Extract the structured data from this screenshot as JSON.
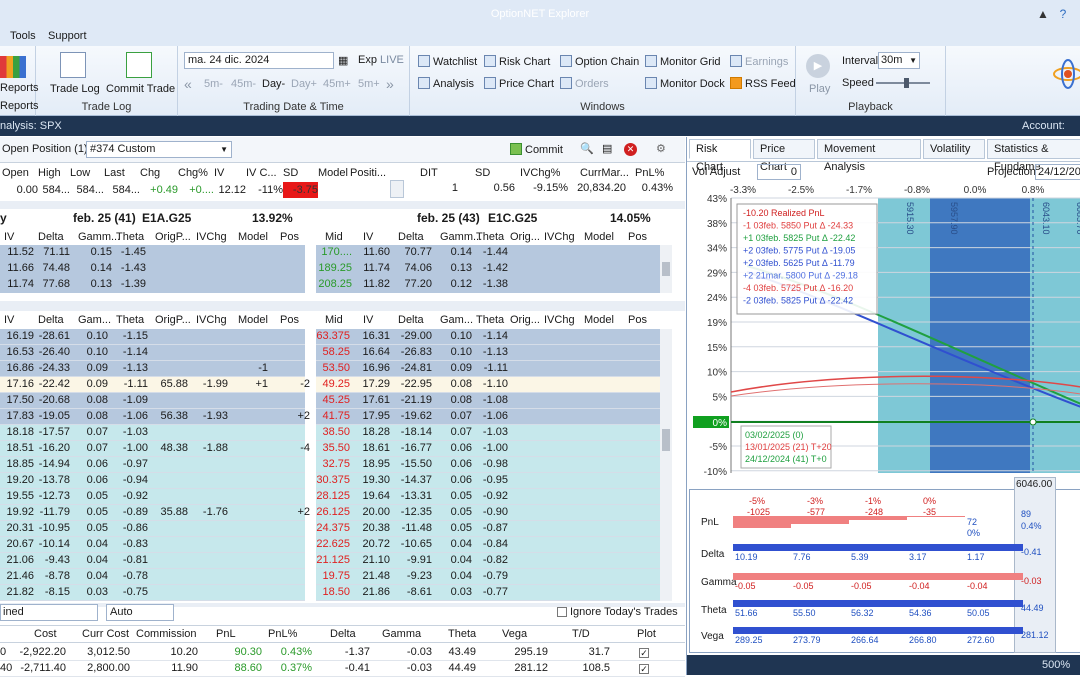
{
  "app": {
    "title": "OptionNET Explorer"
  },
  "menu": [
    "Tools",
    "Support"
  ],
  "ribbon": {
    "reports_label": "Reports",
    "reports_group": "Reports",
    "trade_log": "Trade Log",
    "commit_trade": "Commit Trade",
    "trade_log_group": "Trade Log",
    "date_value": "ma. 24 dic. 2024",
    "exp": "Exp",
    "live": "LIVE",
    "nav": [
      "5m-",
      "45m-",
      "Day-",
      "Day+",
      "45m+",
      "5m+"
    ],
    "date_group": "Trading Date & Time",
    "windows": {
      "watchlist": "Watchlist",
      "risk_chart": "Risk Chart",
      "option_chain": "Option Chain",
      "monitor_grid": "Monitor Grid",
      "earnings": "Earnings",
      "analysis": "Analysis",
      "price_chart": "Price Chart",
      "orders": "Orders",
      "monitor_dock": "Monitor Dock",
      "rss_feed": "RSS Feed",
      "group": "Windows"
    },
    "playback": {
      "play": "Play",
      "interval_label": "Interval",
      "interval_value": "30m",
      "speed_label": "Speed",
      "group": "Playback"
    }
  },
  "status": {
    "left": "nalysis: SPX",
    "right": "Account: Est"
  },
  "position": {
    "label": "Open Position (1)",
    "custom": "#374 Custom",
    "commit": "Commit"
  },
  "top_headers": [
    "Open",
    "High",
    "Low",
    "Last",
    "Chg",
    "Chg%",
    "IV",
    "IV C...",
    "SD",
    "Model",
    "Positi..."
  ],
  "top_values": [
    "0.00",
    "584...",
    "584...",
    "584...",
    "+0.49",
    "+0....",
    "12.12",
    "-11%",
    "-3.75",
    "",
    ""
  ],
  "right_headers": [
    "DIT",
    "SD",
    "IVChg%",
    "CurrMar...",
    "PnL%"
  ],
  "right_values": [
    "1",
    "0.56",
    "-9.15%",
    "20,834.20",
    "0.43%"
  ],
  "sect1": {
    "left_title": "feb. 25 (41)",
    "left_code": "E1A.G25",
    "left_pct": "13.92%",
    "right_title": "feb. 25 (43)",
    "right_code": "E1C.G25",
    "right_pct": "14.05%",
    "lead": "y"
  },
  "calls_headers_left": [
    "IV",
    "Delta",
    "Gamm...",
    "Theta",
    "OrigP...",
    "IVChg",
    "Model",
    "Pos"
  ],
  "calls_headers_right": [
    "Mid",
    "IV",
    "Delta",
    "Gamm...",
    "Theta",
    "Orig...",
    "IVChg",
    "Model",
    "Pos"
  ],
  "calls_left": [
    [
      "11.52",
      "71.11",
      "0.15",
      "-1.45"
    ],
    [
      "11.66",
      "74.48",
      "0.14",
      "-1.43"
    ],
    [
      "11.74",
      "77.68",
      "0.13",
      "-1.39"
    ]
  ],
  "calls_right": [
    [
      "170....",
      "11.60",
      "70.77",
      "0.14",
      "-1.44"
    ],
    [
      "189.25",
      "11.74",
      "74.06",
      "0.13",
      "-1.42"
    ],
    [
      "208.25",
      "11.82",
      "77.20",
      "0.12",
      "-1.38"
    ]
  ],
  "puts_headers_left": [
    "IV",
    "Delta",
    "Gam...",
    "Theta",
    "OrigP...",
    "IVChg",
    "Model",
    "Pos"
  ],
  "puts_headers_right": [
    "Mid",
    "IV",
    "Delta",
    "Gam...",
    "Theta",
    "Orig...",
    "IVChg",
    "Model",
    "Pos"
  ],
  "puts_left": [
    [
      "16.19",
      "-28.61",
      "0.10",
      "-1.15",
      "",
      "",
      "",
      ""
    ],
    [
      "16.53",
      "-26.40",
      "0.10",
      "-1.14",
      "",
      "",
      "",
      ""
    ],
    [
      "16.86",
      "-24.33",
      "0.09",
      "-1.13",
      "",
      "",
      "-1",
      ""
    ],
    [
      "17.16",
      "-22.42",
      "0.09",
      "-1.11",
      "65.88",
      "-1.99",
      "+1",
      "-2"
    ],
    [
      "17.50",
      "-20.68",
      "0.08",
      "-1.09",
      "",
      "",
      "",
      ""
    ],
    [
      "17.83",
      "-19.05",
      "0.08",
      "-1.06",
      "56.38",
      "-1.93",
      "",
      "+2"
    ],
    [
      "18.18",
      "-17.57",
      "0.07",
      "-1.03",
      "",
      "",
      "",
      ""
    ],
    [
      "18.51",
      "-16.20",
      "0.07",
      "-1.00",
      "48.38",
      "-1.88",
      "",
      "-4"
    ],
    [
      "18.85",
      "-14.94",
      "0.06",
      "-0.97",
      "",
      "",
      "",
      ""
    ],
    [
      "19.20",
      "-13.78",
      "0.06",
      "-0.94",
      "",
      "",
      "",
      ""
    ],
    [
      "19.55",
      "-12.73",
      "0.05",
      "-0.92",
      "",
      "",
      "",
      ""
    ],
    [
      "19.92",
      "-11.79",
      "0.05",
      "-0.89",
      "35.88",
      "-1.76",
      "",
      "+2"
    ],
    [
      "20.31",
      "-10.95",
      "0.05",
      "-0.86",
      "",
      "",
      "",
      ""
    ],
    [
      "20.67",
      "-10.14",
      "0.04",
      "-0.83",
      "",
      "",
      "",
      ""
    ],
    [
      "21.06",
      "-9.43",
      "0.04",
      "-0.81",
      "",
      "",
      "",
      ""
    ],
    [
      "21.46",
      "-8.78",
      "0.04",
      "-0.78",
      "",
      "",
      "",
      ""
    ],
    [
      "21.82",
      "-8.15",
      "0.03",
      "-0.75",
      "",
      "",
      "",
      ""
    ]
  ],
  "puts_right": [
    [
      "63.375",
      "16.31",
      "-29.00",
      "0.10",
      "-1.14"
    ],
    [
      "58.25",
      "16.64",
      "-26.83",
      "0.10",
      "-1.13"
    ],
    [
      "53.50",
      "16.96",
      "-24.81",
      "0.09",
      "-1.11"
    ],
    [
      "49.25",
      "17.29",
      "-22.95",
      "0.08",
      "-1.10"
    ],
    [
      "45.25",
      "17.61",
      "-21.19",
      "0.08",
      "-1.08"
    ],
    [
      "41.75",
      "17.95",
      "-19.62",
      "0.07",
      "-1.06"
    ],
    [
      "38.50",
      "18.28",
      "-18.14",
      "0.07",
      "-1.03"
    ],
    [
      "35.50",
      "18.61",
      "-16.77",
      "0.06",
      "-1.00"
    ],
    [
      "32.75",
      "18.95",
      "-15.50",
      "0.06",
      "-0.98"
    ],
    [
      "30.375",
      "19.30",
      "-14.37",
      "0.06",
      "-0.95"
    ],
    [
      "28.125",
      "19.64",
      "-13.31",
      "0.05",
      "-0.92"
    ],
    [
      "26.125",
      "20.00",
      "-12.35",
      "0.05",
      "-0.90"
    ],
    [
      "24.375",
      "20.38",
      "-11.48",
      "0.05",
      "-0.87"
    ],
    [
      "22.625",
      "20.72",
      "-10.65",
      "0.04",
      "-0.84"
    ],
    [
      "21.125",
      "21.10",
      "-9.91",
      "0.04",
      "-0.82"
    ],
    [
      "19.75",
      "21.48",
      "-9.23",
      "0.04",
      "-0.79"
    ],
    [
      "18.50",
      "21.86",
      "-8.61",
      "0.03",
      "-0.77"
    ]
  ],
  "bottom": {
    "combo1": "ined",
    "combo2": "Auto",
    "ignore": "Ignore Today's Trades",
    "headers": [
      "Cost",
      "Curr Cost",
      "Commission",
      "PnL",
      "PnL%",
      "Delta",
      "Gamma",
      "Theta",
      "Vega",
      "T/D",
      "Plot"
    ],
    "rows": [
      [
        "-2,922.20",
        "3,012.50",
        "10.20",
        "90.30",
        "0.43%",
        "-1.37",
        "-0.03",
        "43.49",
        "295.19",
        "31.7"
      ],
      [
        "-2,711.40",
        "2,800.00",
        "11.90",
        "88.60",
        "0.37%",
        "-0.41",
        "-0.03",
        "44.49",
        "281.12",
        "108.5"
      ]
    ],
    "row_prefix": [
      "0",
      "40"
    ]
  },
  "right_panel": {
    "tabs": [
      "Risk Chart",
      "Price Chart",
      "Movement Analysis",
      "Volatility",
      "Statistics & Fundame"
    ],
    "vol_adjust": "Vol Adjust",
    "vol_value": "0",
    "projection": "Projection",
    "projection_value": "24/12/202",
    "pct_top": [
      "-3.3%",
      "-2.5%",
      "-1.7%",
      "-0.8%",
      "0.0%",
      "0.8%"
    ],
    "y_labels": [
      "43%",
      "38%",
      "34%",
      "29%",
      "24%",
      "19%",
      "15%",
      "10%",
      "5%",
      "0%",
      "-5%",
      "-10%"
    ],
    "x_labels": [
      "5800",
      "5850",
      "5900",
      "5950",
      "6000",
      "6046.00"
    ],
    "vlabels": [
      "5915.30",
      "5957.90",
      "6043.10",
      "6085.70"
    ],
    "legend": [
      "-10.20 Realized PnL",
      "-1 03feb. 5850 Put Δ  -24.33",
      "+1 03feb. 5825 Put Δ  -22.42",
      "+2 03feb. 5775 Put Δ  -19.05",
      "+2 03feb. 5625 Put Δ  -11.79",
      "+2 21mar. 5800 Put Δ  -29.18",
      "-4 03feb. 5725 Put Δ  -16.20",
      "-2 03feb. 5825 Put Δ  -22.42"
    ],
    "dates": [
      "03/02/2025 (0)",
      "13/01/2025 (21) T+20",
      "24/12/2024 (41) T+0"
    ],
    "stats_rows": [
      "PnL",
      "Delta",
      "Gamma",
      "Theta",
      "Vega"
    ],
    "pnl_top": [
      "-5%",
      "-3%",
      "-1%",
      "0%"
    ],
    "pnl_vals": [
      "-1025",
      "-577",
      "-248",
      "-35",
      "72",
      "0%",
      "89",
      "0.4%"
    ],
    "delta_vals": [
      "10.19",
      "7.76",
      "5.39",
      "3.17",
      "1.17",
      "-0.41"
    ],
    "gamma_vals": [
      "-0.05",
      "-0.05",
      "-0.05",
      "-0.04",
      "-0.04",
      "-0.03"
    ],
    "theta_vals": [
      "51.66",
      "55.50",
      "56.32",
      "54.36",
      "50.05",
      "44.49"
    ],
    "vega_vals": [
      "289.25",
      "273.79",
      "266.64",
      "266.80",
      "272.60",
      "281.12"
    ],
    "zoom": "500%"
  }
}
